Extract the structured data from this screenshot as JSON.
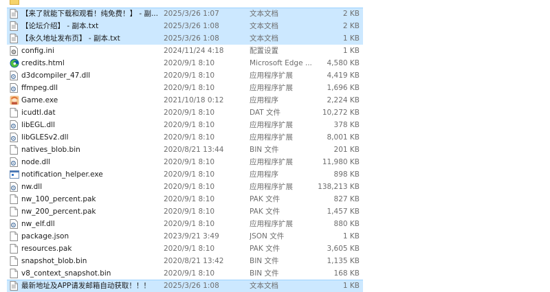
{
  "files": [
    {
      "name": "",
      "date": "",
      "type": "",
      "size": "",
      "icon": "folder-icon",
      "selected": false
    },
    {
      "name": "【来了就能下载和观看！纯免费！】 - 副...",
      "date": "2025/3/26 1:07",
      "type": "文本文档",
      "size": "2 KB",
      "icon": "text-file-icon",
      "selected": true
    },
    {
      "name": "【论坛介绍】 - 副本.txt",
      "date": "2025/3/26 1:08",
      "type": "文本文档",
      "size": "2 KB",
      "icon": "text-file-icon",
      "selected": true
    },
    {
      "name": "【永久地址发布页】 - 副本.txt",
      "date": "2025/3/26 1:08",
      "type": "文本文档",
      "size": "1 KB",
      "icon": "text-file-icon",
      "selected": true
    },
    {
      "name": "config.ini",
      "date": "2024/11/24 4:18",
      "type": "配置设置",
      "size": "1 KB",
      "icon": "settings-file-icon",
      "selected": false
    },
    {
      "name": "credits.html",
      "date": "2020/9/1 8:10",
      "type": "Microsoft Edge ...",
      "size": "4,580 KB",
      "icon": "edge-icon",
      "selected": false
    },
    {
      "name": "d3dcompiler_47.dll",
      "date": "2020/9/1 8:10",
      "type": "应用程序扩展",
      "size": "4,419 KB",
      "icon": "dll-file-icon",
      "selected": false
    },
    {
      "name": "ffmpeg.dll",
      "date": "2020/9/1 8:10",
      "type": "应用程序扩展",
      "size": "1,696 KB",
      "icon": "dll-file-icon",
      "selected": false
    },
    {
      "name": "Game.exe",
      "date": "2021/10/18 0:12",
      "type": "应用程序",
      "size": "2,224 KB",
      "icon": "game-app-icon",
      "selected": false
    },
    {
      "name": "icudtl.dat",
      "date": "2020/9/1 8:10",
      "type": "DAT 文件",
      "size": "10,272 KB",
      "icon": "blank-file-icon",
      "selected": false
    },
    {
      "name": "libEGL.dll",
      "date": "2020/9/1 8:10",
      "type": "应用程序扩展",
      "size": "378 KB",
      "icon": "dll-file-icon",
      "selected": false
    },
    {
      "name": "libGLESv2.dll",
      "date": "2020/9/1 8:10",
      "type": "应用程序扩展",
      "size": "8,001 KB",
      "icon": "dll-file-icon",
      "selected": false
    },
    {
      "name": "natives_blob.bin",
      "date": "2020/8/21 13:44",
      "type": "BIN 文件",
      "size": "201 KB",
      "icon": "blank-file-icon",
      "selected": false
    },
    {
      "name": "node.dll",
      "date": "2020/9/1 8:10",
      "type": "应用程序扩展",
      "size": "11,980 KB",
      "icon": "dll-file-icon",
      "selected": false
    },
    {
      "name": "notification_helper.exe",
      "date": "2020/9/1 8:10",
      "type": "应用程序",
      "size": "898 KB",
      "icon": "exe-app-icon",
      "selected": false
    },
    {
      "name": "nw.dll",
      "date": "2020/9/1 8:10",
      "type": "应用程序扩展",
      "size": "138,213 KB",
      "icon": "dll-file-icon",
      "selected": false
    },
    {
      "name": "nw_100_percent.pak",
      "date": "2020/9/1 8:10",
      "type": "PAK 文件",
      "size": "827 KB",
      "icon": "blank-file-icon",
      "selected": false
    },
    {
      "name": "nw_200_percent.pak",
      "date": "2020/9/1 8:10",
      "type": "PAK 文件",
      "size": "1,457 KB",
      "icon": "blank-file-icon",
      "selected": false
    },
    {
      "name": "nw_elf.dll",
      "date": "2020/9/1 8:10",
      "type": "应用程序扩展",
      "size": "880 KB",
      "icon": "dll-file-icon",
      "selected": false
    },
    {
      "name": "package.json",
      "date": "2023/9/21 3:49",
      "type": "JSON 文件",
      "size": "1 KB",
      "icon": "blank-file-icon",
      "selected": false
    },
    {
      "name": "resources.pak",
      "date": "2020/9/1 8:10",
      "type": "PAK 文件",
      "size": "3,605 KB",
      "icon": "blank-file-icon",
      "selected": false
    },
    {
      "name": "snapshot_blob.bin",
      "date": "2020/8/21 13:42",
      "type": "BIN 文件",
      "size": "1,135 KB",
      "icon": "blank-file-icon",
      "selected": false
    },
    {
      "name": "v8_context_snapshot.bin",
      "date": "2020/9/1 8:10",
      "type": "BIN 文件",
      "size": "168 KB",
      "icon": "blank-file-icon",
      "selected": false
    },
    {
      "name": "最新地址及APP请发邮箱自动获取！！！",
      "date": "2025/3/26 1:08",
      "type": "文本文档",
      "size": "1 KB",
      "icon": "text-file-icon",
      "selected": true
    }
  ],
  "colors": {
    "selection": "#cce8ff",
    "selection_border": "#99d1ff",
    "edge_blue": "#0c59a4",
    "edge_green": "#51c03e"
  }
}
